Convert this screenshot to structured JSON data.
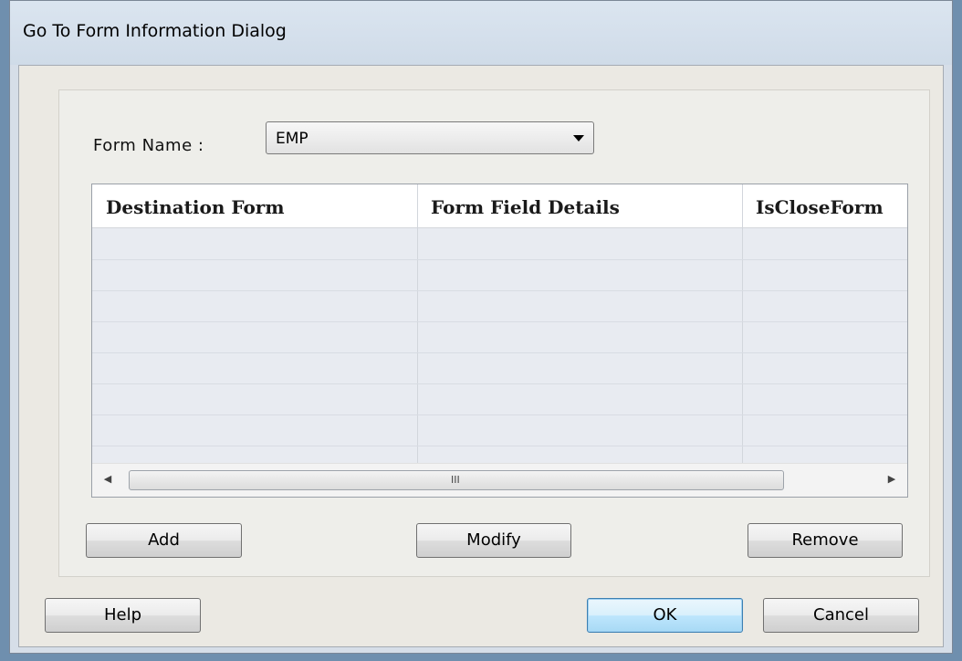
{
  "window": {
    "title": "Go To Form Information Dialog"
  },
  "form": {
    "label": "Form Name :",
    "selected_value": "EMP"
  },
  "grid": {
    "columns": [
      "Destination Form",
      "Form Field Details",
      "IsCloseForm"
    ],
    "rows": [],
    "scrollbar_grip": "III"
  },
  "actions": {
    "add": "Add",
    "modify": "Modify",
    "remove": "Remove"
  },
  "footer": {
    "help": "Help",
    "ok": "OK",
    "cancel": "Cancel"
  },
  "icons": {
    "dropdown": "chevron-down-icon",
    "scroll_left": "scroll-left-arrow-icon",
    "scroll_right": "scroll-right-arrow-icon"
  },
  "colors": {
    "dialog_background": "#ebe9e3",
    "titlebar": "#dbe5f0",
    "default_button_border": "#3c7fb1"
  }
}
